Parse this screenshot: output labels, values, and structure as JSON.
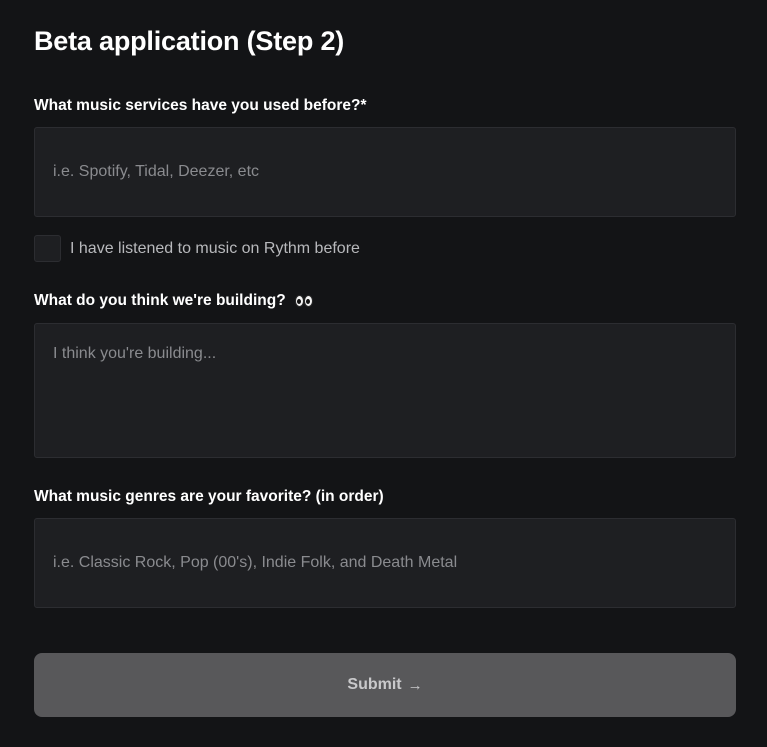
{
  "form": {
    "title": "Beta application (Step 2)",
    "services": {
      "label": "What music services have you used before?*",
      "placeholder": "i.e. Spotify, Tidal, Deezer, etc",
      "value": ""
    },
    "rythm_checkbox": {
      "label": "I have listened to music on Rythm before",
      "checked": false
    },
    "building": {
      "label": "What do you think we're building?",
      "icon": "eyes-icon",
      "placeholder": "I think you're building...",
      "value": ""
    },
    "genres": {
      "label": "What music genres are your favorite? (in order)",
      "placeholder": "i.e. Classic Rock, Pop (00's), Indie Folk, and Death Metal",
      "value": ""
    },
    "submit": {
      "label": "Submit",
      "arrow": "→"
    }
  },
  "colors": {
    "background": "#131416",
    "field_background": "#1e1f22",
    "submit_background": "#58585a",
    "placeholder": "#8a8b8f"
  }
}
